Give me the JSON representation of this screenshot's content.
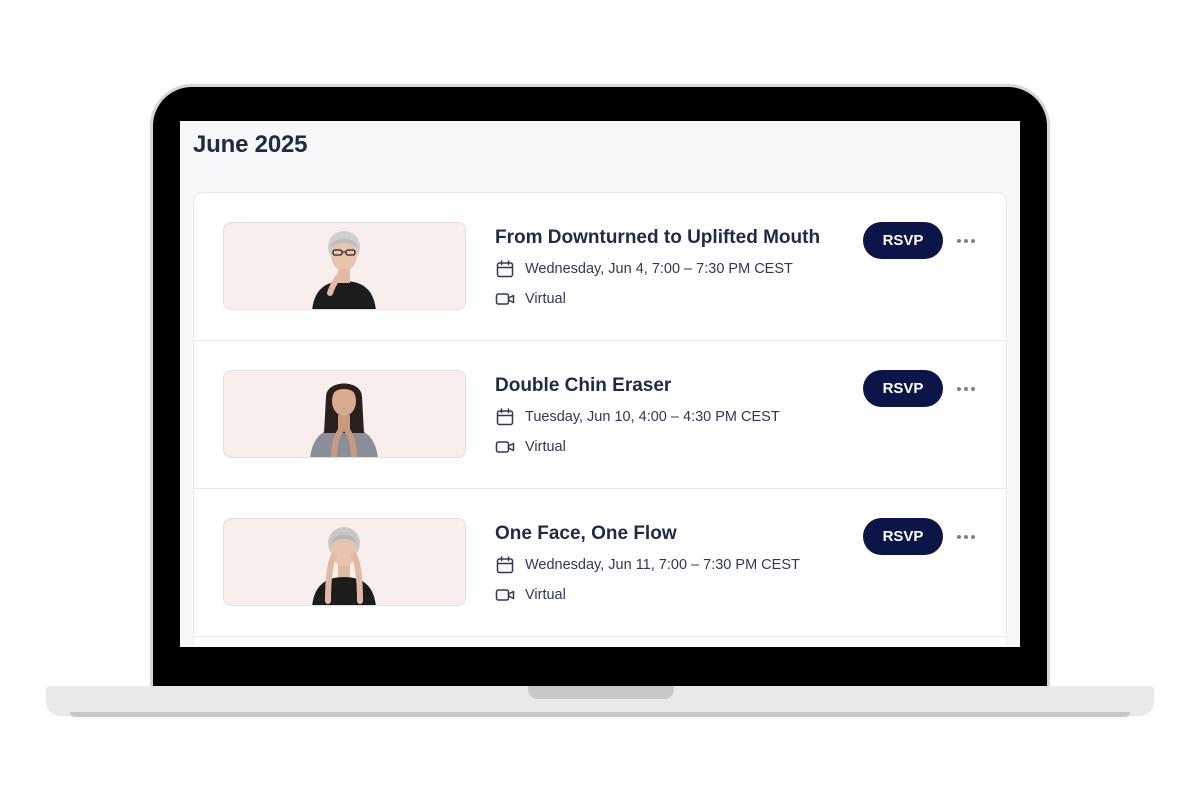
{
  "page": {
    "title": "June 2025"
  },
  "events": [
    {
      "title": "From Downturned to Uplifted Mouth",
      "date": "Wednesday, Jun 4, 7:00 – 7:30 PM CEST",
      "venue": "Virtual",
      "rsvp_label": "RSVP",
      "thumbnail_icon": "instructor-photo-gray-hair-glasses"
    },
    {
      "title": "Double Chin Eraser",
      "date": "Tuesday, Jun 10, 4:00 – 4:30 PM CEST",
      "venue": "Virtual",
      "rsvp_label": "RSVP",
      "thumbnail_icon": "instructor-photo-dark-hair"
    },
    {
      "title": "One Face, One Flow",
      "date": "Wednesday, Jun 11, 7:00 – 7:30 PM CEST",
      "venue": "Virtual",
      "rsvp_label": "RSVP",
      "thumbnail_icon": "instructor-photo-gray-hair"
    }
  ],
  "icons": {
    "date": "calendar-icon",
    "venue": "video-camera-icon",
    "more": "more-horizontal-icon"
  },
  "colors": {
    "accent": "#0b1547",
    "thumbnail_bg": "#f8efed",
    "screen_bg": "#f7f8fa"
  }
}
